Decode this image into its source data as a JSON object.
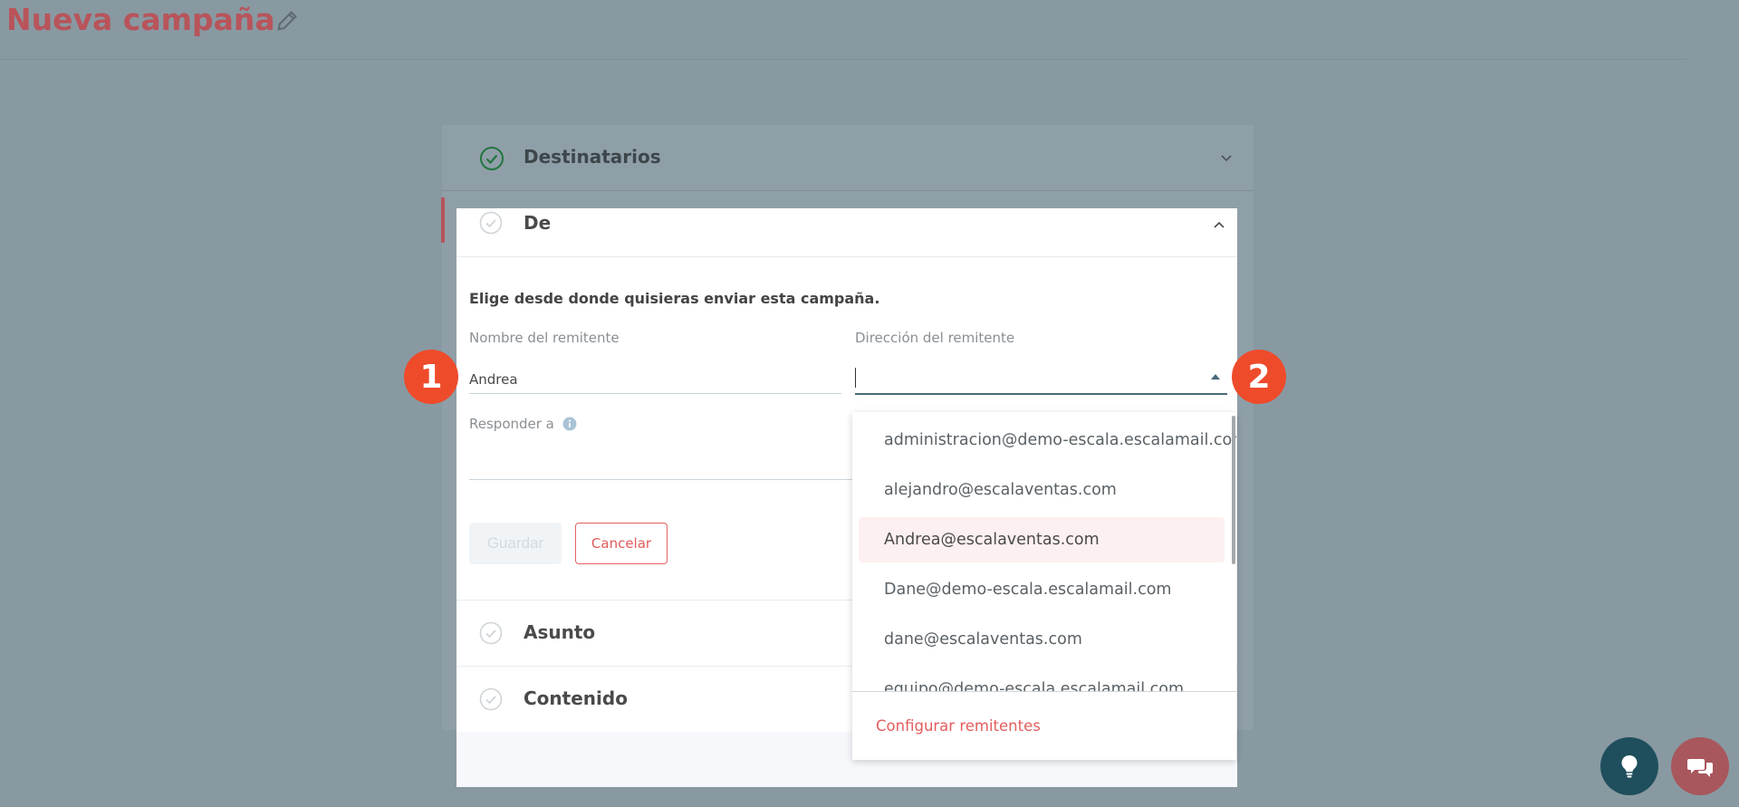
{
  "header": {
    "title": "Nueva campaña"
  },
  "sections": {
    "destinatarios": "Destinatarios",
    "de": "De",
    "asunto": "Asunto",
    "contenido": "Contenido"
  },
  "form": {
    "intro": "Elige desde donde quisieras enviar esta campaña.",
    "sender_name_label": "Nombre del remitente",
    "sender_name_value": "Andrea",
    "sender_address_label": "Dirección del remitente",
    "sender_address_value": "",
    "reply_to_label": "Responder a",
    "save_label": "Guardar",
    "cancel_label": "Cancelar"
  },
  "dropdown": {
    "options": [
      "administracion@demo-escala.escalamail.com",
      "alejandro@escalaventas.com",
      "Andrea@escalaventas.com",
      "Dane@demo-escala.escalamail.com",
      "dane@escalaventas.com",
      "equipo@demo-escala.escalamail.com"
    ],
    "highlighted_index": 2,
    "config_link": "Configurar remitentes"
  },
  "badges": {
    "one": "1",
    "two": "2"
  },
  "colors": {
    "accent_red": "#e05a5a",
    "title_red": "#b8545a",
    "badge": "#ee4b2b",
    "active_field": "#466a7a",
    "check_green": "#2e8b57"
  },
  "icons": {
    "edit": "pencil-icon",
    "done": "check-circle-icon",
    "info": "info-icon",
    "help": "lightbulb-icon",
    "chat": "chat-icon"
  }
}
